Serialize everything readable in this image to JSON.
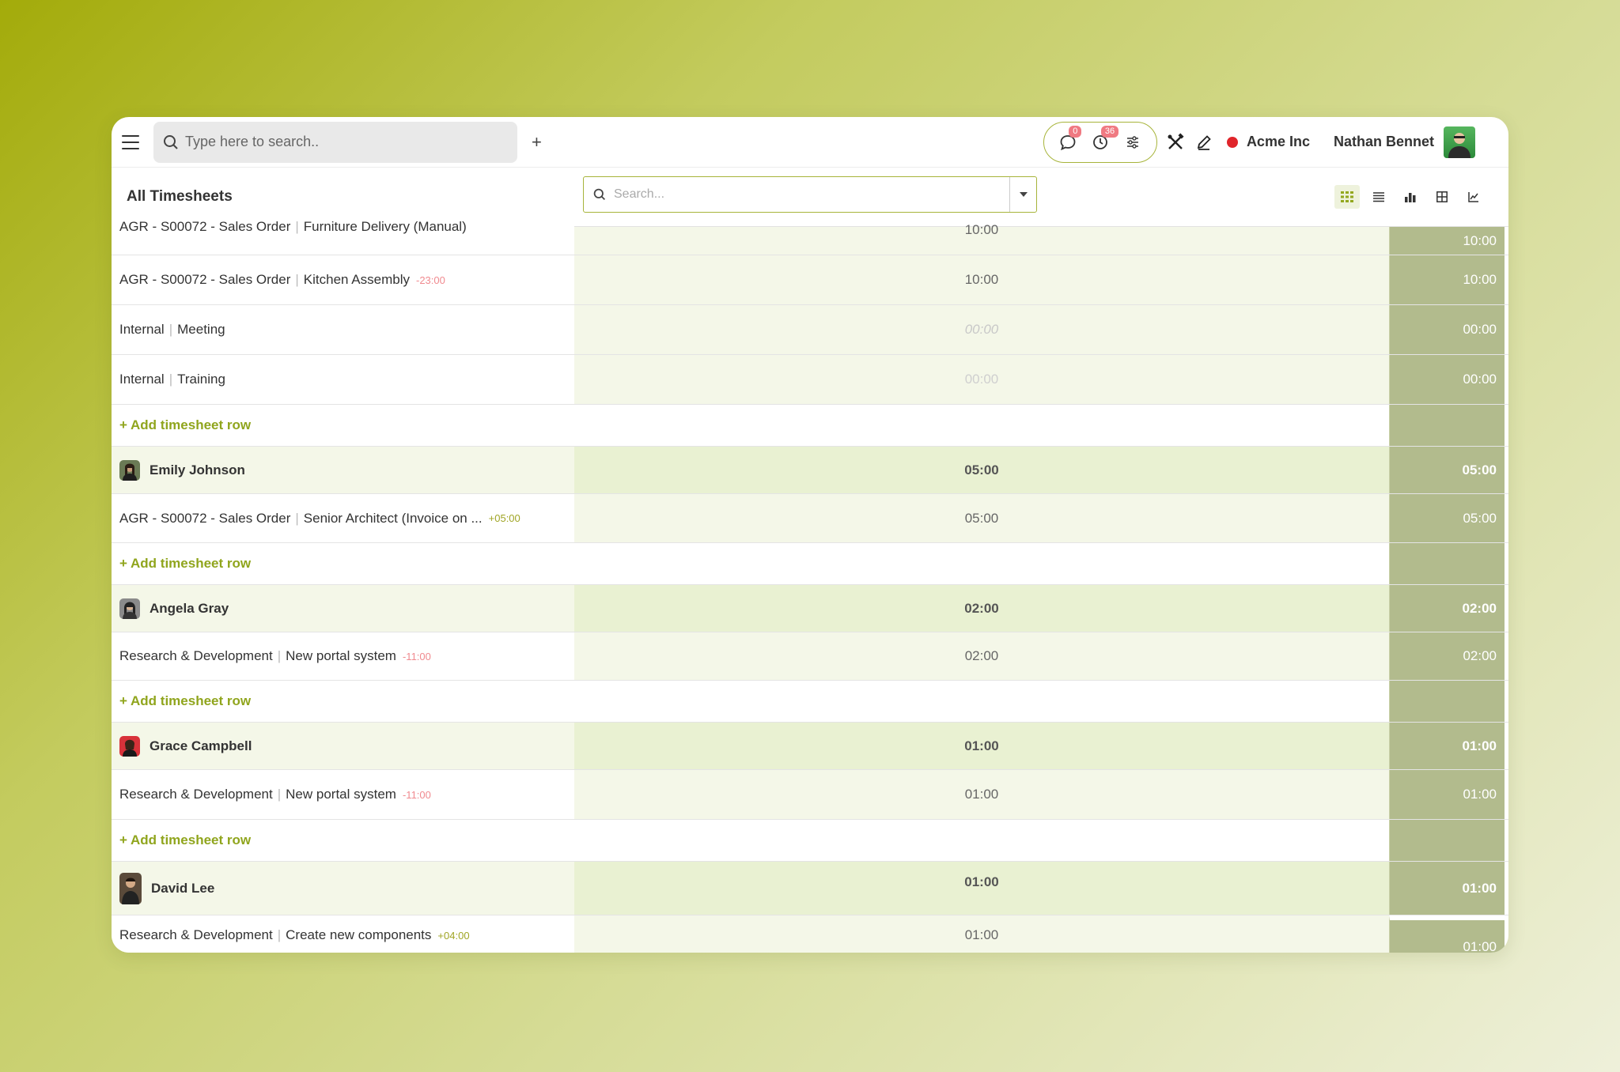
{
  "topbar": {
    "search_placeholder": "Type here to search..",
    "plus_label": "+",
    "messages_badge": "0",
    "activities_badge": "36",
    "company": "Acme Inc",
    "user": "Nathan Bennet"
  },
  "subbar": {
    "title": "All Timesheets",
    "search_placeholder": "Search..."
  },
  "rows": {
    "r1": {
      "project": "AGR - S00072 - Sales Order",
      "task": "Furniture Delivery (Manual)",
      "hours": "10:00",
      "total": "10:00"
    },
    "r2": {
      "project": "AGR - S00072 - Sales Order",
      "task": "Kitchen Assembly",
      "delta": "-23:00",
      "hours": "10:00",
      "total": "10:00"
    },
    "r3": {
      "project": "Internal",
      "task": "Meeting",
      "hours": "00:00",
      "total": "00:00"
    },
    "r4": {
      "project": "Internal",
      "task": "Training",
      "hours": "00:00",
      "total": "00:00"
    },
    "add1": "+ Add timesheet row",
    "g_emily": {
      "name": "Emily Johnson",
      "hours": "05:00",
      "total": "05:00"
    },
    "r5": {
      "project": "AGR - S00072 - Sales Order",
      "task": "Senior Architect (Invoice on ...",
      "delta": "+05:00",
      "hours": "05:00",
      "total": "05:00"
    },
    "add2": "+ Add timesheet row",
    "g_angela": {
      "name": "Angela Gray",
      "hours": "02:00",
      "total": "02:00"
    },
    "r6": {
      "project": "Research & Development",
      "task": "New portal system",
      "delta": "-11:00",
      "hours": "02:00",
      "total": "02:00"
    },
    "add3": "+ Add timesheet row",
    "g_grace": {
      "name": "Grace Campbell",
      "hours": "01:00",
      "total": "01:00"
    },
    "r7": {
      "project": "Research & Development",
      "task": "New portal system",
      "delta": "-11:00",
      "hours": "01:00",
      "total": "01:00"
    },
    "add4": "+ Add timesheet row",
    "g_david": {
      "name": "David Lee",
      "hours": "01:00",
      "total": "01:00"
    },
    "r8": {
      "project": "Research & Development",
      "task": "Create new components",
      "delta": "+04:00",
      "hours": "01:00",
      "total": "01:00"
    }
  },
  "colors": {
    "accent": "#a7b43a",
    "total_column": "#b2bb8d",
    "negative": "#f08a8f",
    "positive": "#a0a525"
  }
}
